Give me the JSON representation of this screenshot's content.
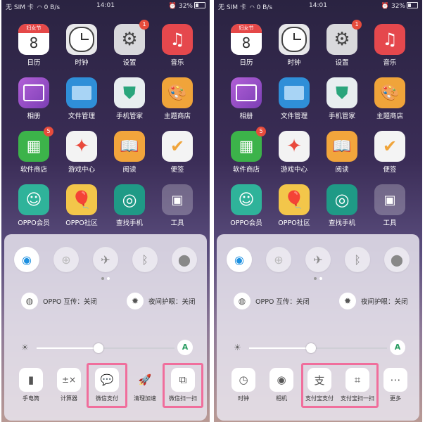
{
  "status": {
    "carrier": "无 SIM 卡",
    "speed": "0 B/s",
    "time": "14:01",
    "battery": "32%"
  },
  "apps": [
    {
      "label": "日历",
      "icon": "calendar-icon",
      "calendar_tag": "妇女节",
      "calendar_day": "8"
    },
    {
      "label": "时钟",
      "icon": "clock-icon"
    },
    {
      "label": "设置",
      "icon": "gear-icon",
      "badge": "1"
    },
    {
      "label": "音乐",
      "icon": "music-note-icon"
    },
    {
      "label": "相册",
      "icon": "photo-icon"
    },
    {
      "label": "文件管理",
      "icon": "folder-icon"
    },
    {
      "label": "手机管家",
      "icon": "shield-icon"
    },
    {
      "label": "主题商店",
      "icon": "palette-icon"
    },
    {
      "label": "软件商店",
      "icon": "app-grid-icon",
      "badge": "5"
    },
    {
      "label": "游戏中心",
      "icon": "game-star-icon"
    },
    {
      "label": "阅读",
      "icon": "book-icon"
    },
    {
      "label": "便签",
      "icon": "checkmark-note-icon"
    },
    {
      "label": "OPPO会员",
      "icon": "member-face-icon"
    },
    {
      "label": "OPPO社区",
      "icon": "balloon-icon"
    },
    {
      "label": "查找手机",
      "icon": "radar-icon"
    },
    {
      "label": "工具",
      "icon": "folder-tools-icon"
    }
  ],
  "panel": {
    "info_left": "OPPO 互传：关闭",
    "info_right": "夜间护眼：关闭",
    "auto_brightness": "A",
    "brightness": 0.45
  },
  "left_actions": [
    {
      "label": "手电筒",
      "icon": "flashlight-icon"
    },
    {
      "label": "计算器",
      "icon": "calculator-icon"
    },
    {
      "label": "微信支付",
      "icon": "wechat-pay-icon"
    },
    {
      "label": "清理加速",
      "icon": "rocket-icon"
    },
    {
      "label": "微信扫一扫",
      "icon": "wechat-scan-icon"
    }
  ],
  "right_actions": [
    {
      "label": "时钟",
      "icon": "clock-icon"
    },
    {
      "label": "相机",
      "icon": "camera-icon"
    },
    {
      "label": "支付宝支付",
      "icon": "alipay-icon"
    },
    {
      "label": "支付宝扫一扫",
      "icon": "alipay-scan-icon"
    },
    {
      "label": "更多",
      "icon": "more-dots-icon"
    }
  ],
  "colors": {
    "highlight": "#f06e9c",
    "accent_green": "#2a9d62",
    "badge_red": "#e74c3c"
  }
}
